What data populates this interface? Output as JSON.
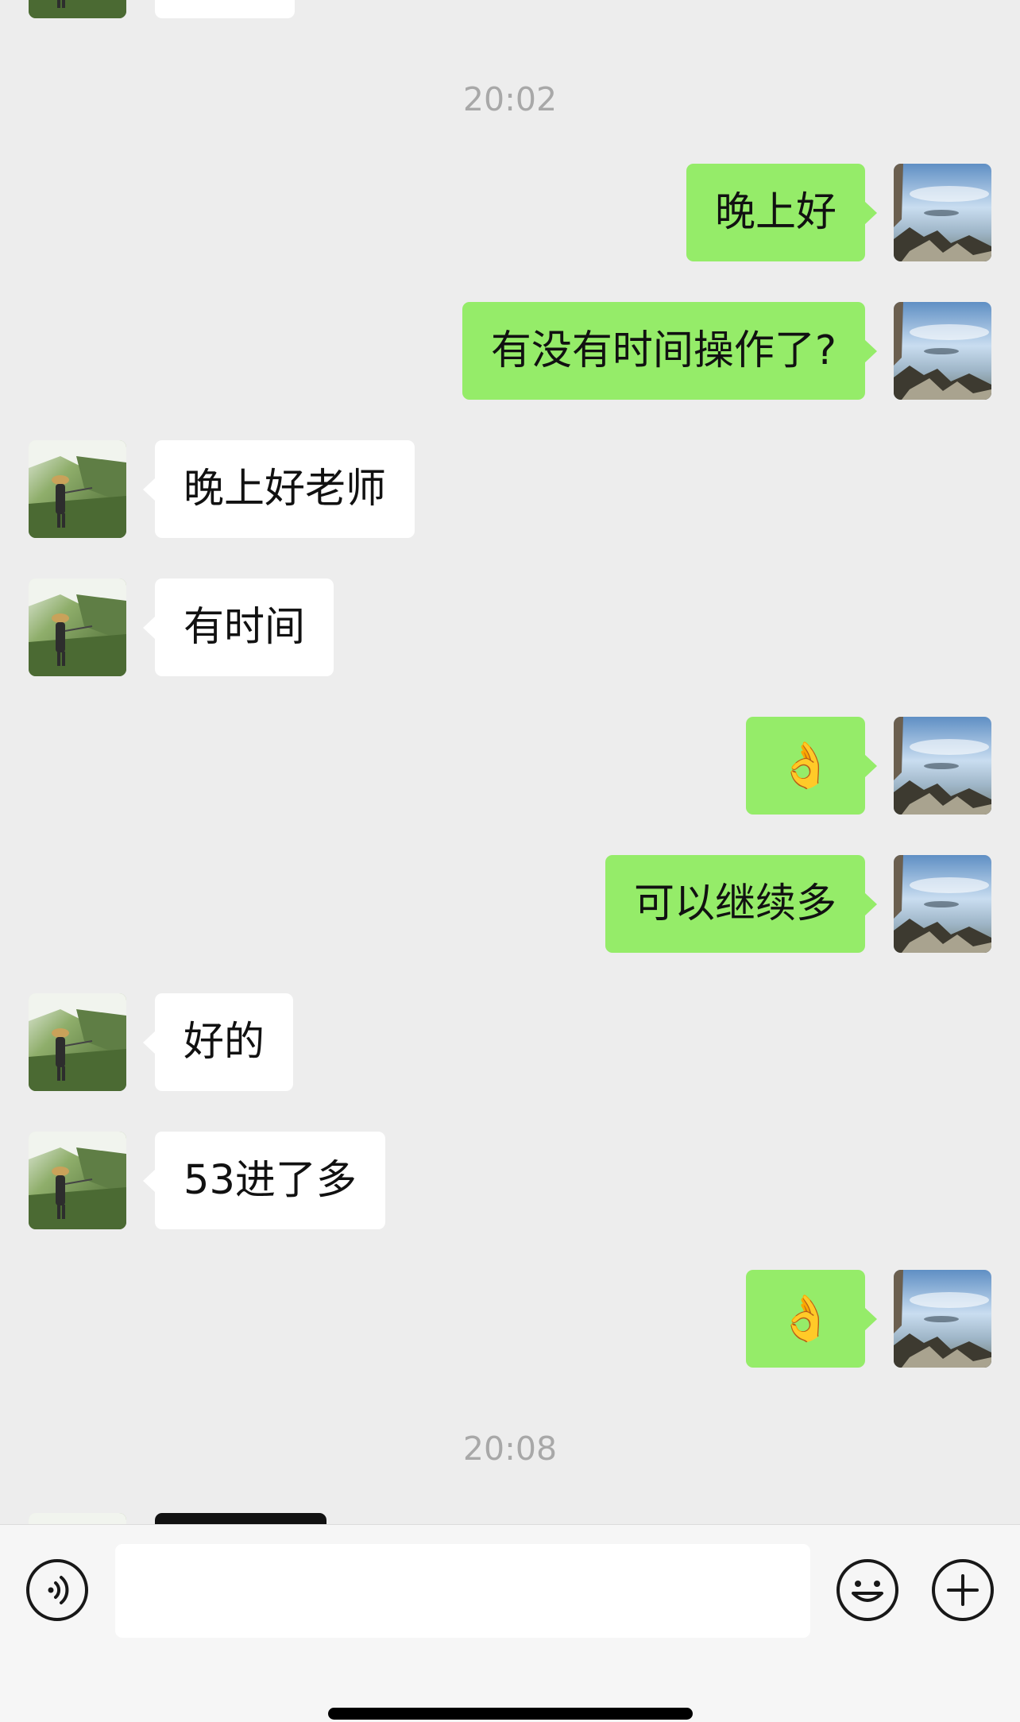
{
  "chat": {
    "timestamps": [
      "20:02",
      "20:08"
    ],
    "messages": [
      {
        "side": "self",
        "text": "晚上好"
      },
      {
        "side": "self",
        "text": "有没有时间操作了?"
      },
      {
        "side": "peer",
        "text": "晚上好老师"
      },
      {
        "side": "peer",
        "text": "有时间"
      },
      {
        "side": "self",
        "text": "👌"
      },
      {
        "side": "self",
        "text": "可以继续多"
      },
      {
        "side": "peer",
        "text": "好的"
      },
      {
        "side": "peer",
        "text": "53进了多"
      },
      {
        "side": "self",
        "text": "👌"
      }
    ]
  },
  "input_bar": {
    "value": "",
    "placeholder": "",
    "icons": [
      "voice-icon",
      "emoji-icon",
      "plus-icon"
    ]
  },
  "colors": {
    "background": "#ededed",
    "self_bubble": "#95ec69",
    "peer_bubble": "#ffffff",
    "timestamp_text": "#a8a8a8"
  }
}
